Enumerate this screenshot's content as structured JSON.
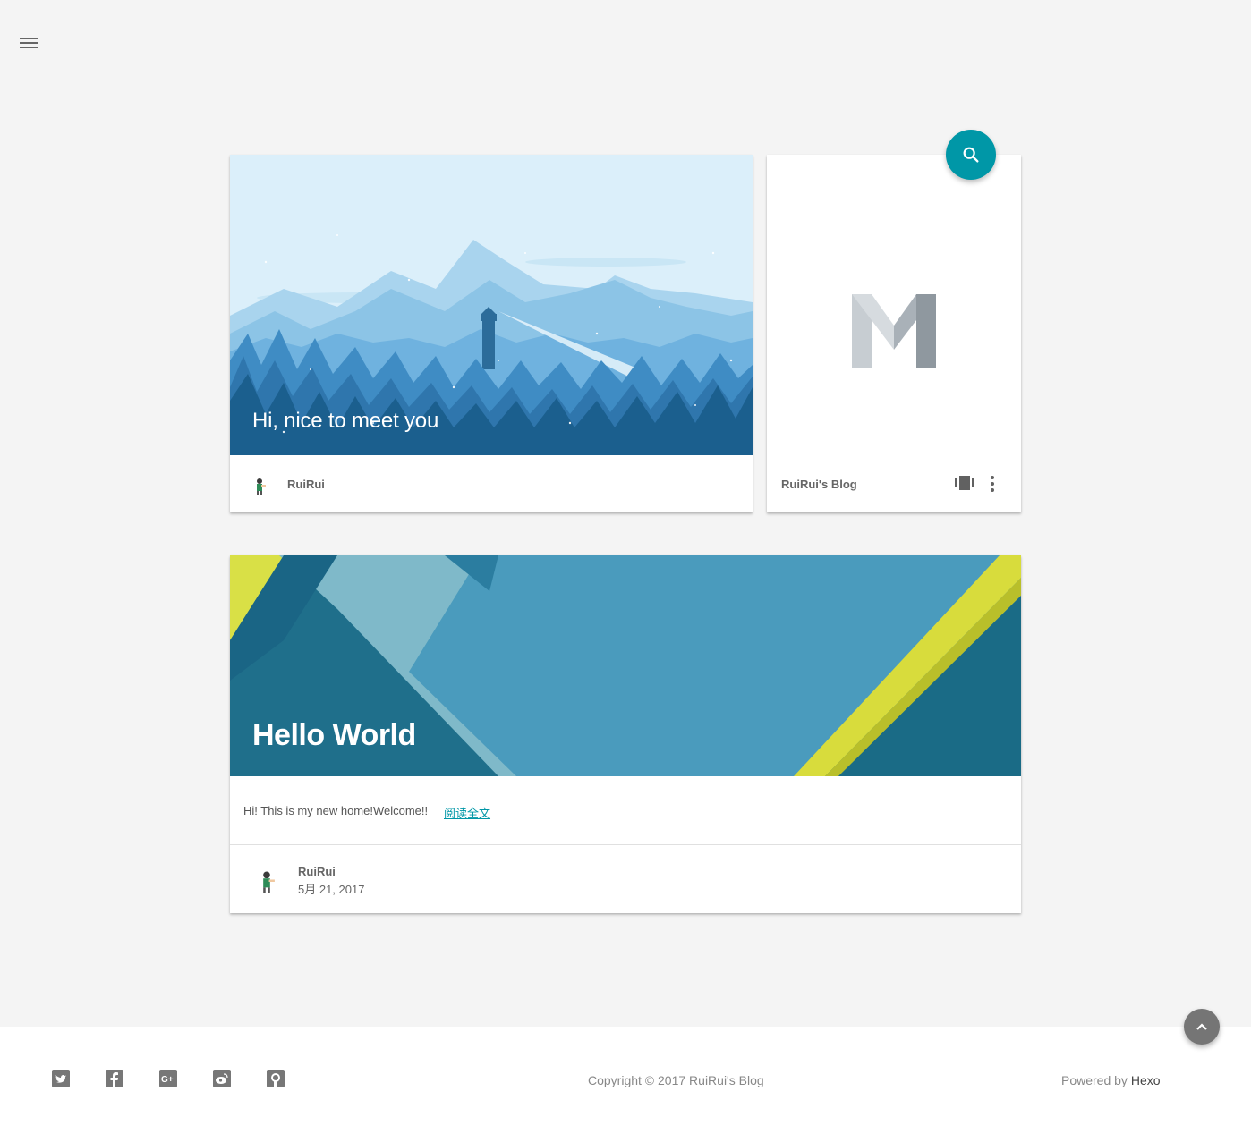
{
  "nav": {
    "menu_icon": "menu-icon"
  },
  "welcome_card": {
    "title": "Hi, nice to meet you",
    "author": "RuiRui"
  },
  "blog_card": {
    "logo_letter": "M",
    "title": "RuiRui's Blog",
    "icons": [
      "view-carousel-icon",
      "more-vert-icon"
    ]
  },
  "search_fab": {
    "icon": "search-icon",
    "color": "#0097a7"
  },
  "post_card": {
    "title": "Hello World",
    "excerpt": "Hi! This is my new home!Welcome!!",
    "read_more": "阅读全文",
    "author": "RuiRui",
    "date": "5月 21, 2017"
  },
  "back_to_top": {
    "icon": "chevron-up-icon"
  },
  "footer": {
    "social_icons": [
      "twitter-icon",
      "facebook-icon",
      "google-plus-icon",
      "weibo-icon",
      "github-icon"
    ],
    "copyright": "Copyright ©  2017  RuiRui's Blog",
    "powered_prefix": "Powered by ",
    "powered_link": "Hexo"
  },
  "colors": {
    "accent": "#0097a7",
    "background": "#f4f4f4"
  }
}
